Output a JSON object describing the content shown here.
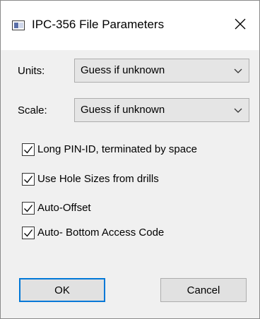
{
  "window": {
    "title": "IPC-356 File Parameters",
    "icon": "window-icon",
    "close_icon": "close-icon"
  },
  "fields": {
    "units": {
      "label": "Units:",
      "value": "Guess if unknown"
    },
    "scale": {
      "label": "Scale:",
      "value": "Guess if unknown"
    }
  },
  "options": [
    {
      "label": "Long PIN-ID, terminated by space",
      "checked": true
    },
    {
      "label": "Use Hole Sizes from drills",
      "checked": true
    },
    {
      "label": "Auto-Offset",
      "checked": true
    },
    {
      "label": "Auto- Bottom Access Code",
      "checked": true
    }
  ],
  "buttons": {
    "ok": "OK",
    "cancel": "Cancel"
  },
  "colors": {
    "accent": "#0078d7",
    "dialog_bg": "#f0f0f0",
    "titlebar_bg": "#ffffff"
  }
}
